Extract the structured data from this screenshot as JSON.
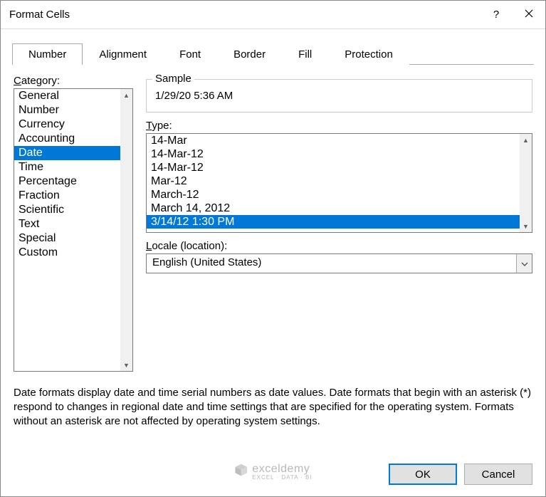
{
  "title": "Format Cells",
  "tabs": [
    "Number",
    "Alignment",
    "Font",
    "Border",
    "Fill",
    "Protection"
  ],
  "active_tab": 0,
  "category": {
    "label_pre": "C",
    "label_post": "ategory:",
    "items": [
      "General",
      "Number",
      "Currency",
      "Accounting",
      "Date",
      "Time",
      "Percentage",
      "Fraction",
      "Scientific",
      "Text",
      "Special",
      "Custom"
    ],
    "selected_index": 4
  },
  "sample": {
    "legend": "Sample",
    "value": "1/29/20 5:36 AM"
  },
  "type": {
    "label_pre": "T",
    "label_post": "ype:",
    "items": [
      "14-Mar",
      "14-Mar-12",
      "14-Mar-12",
      "Mar-12",
      "March-12",
      "March 14, 2012",
      "3/14/12 1:30 PM"
    ],
    "selected_index": 6
  },
  "locale": {
    "label_pre": "L",
    "label_post": "ocale (location):",
    "value": "English (United States)"
  },
  "description": "Date formats display date and time serial numbers as date values.  Date formats that begin with an asterisk (*) respond to changes in regional date and time settings that are specified for the operating system. Formats without an asterisk are not affected by operating system settings.",
  "buttons": {
    "ok": "OK",
    "cancel": "Cancel"
  },
  "watermark": {
    "brand": "exceldemy",
    "tagline": "EXCEL · DATA · BI"
  }
}
